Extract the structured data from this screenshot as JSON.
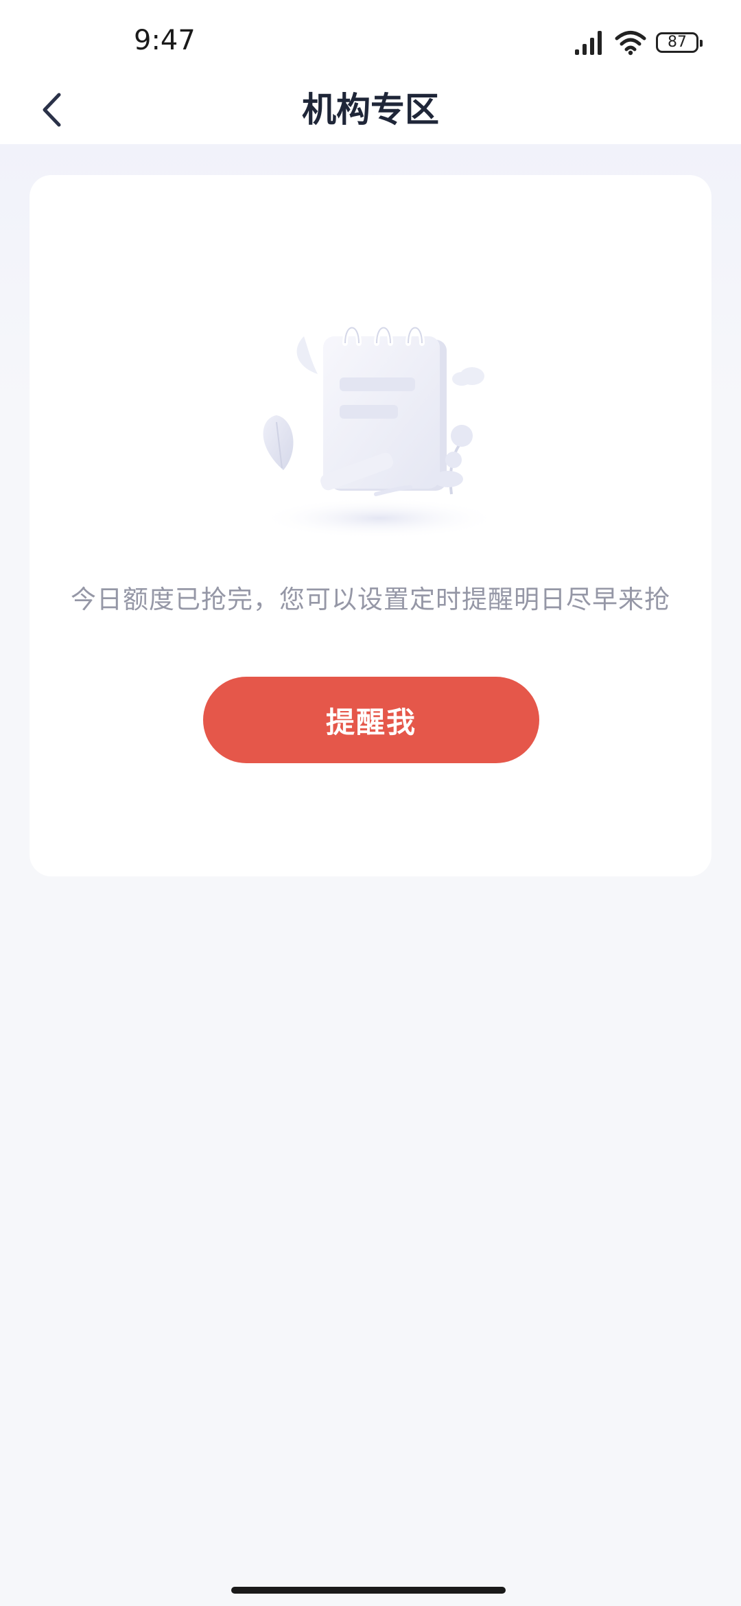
{
  "status_bar": {
    "time": "9:47",
    "battery_level": "87",
    "icons": [
      "signal-icon",
      "wifi-icon",
      "battery-icon"
    ]
  },
  "nav": {
    "back_icon": "chevron-left-icon",
    "title": "机构专区"
  },
  "empty_state": {
    "illustration": "empty-notepad-illustration",
    "message": "今日额度已抢完，您可以设置定时提醒明日尽早来抢",
    "button_label": "提醒我"
  },
  "colors": {
    "accent": "#e5574a",
    "title_text": "#1f2638",
    "muted_text": "#9597a6",
    "background": "#f6f7fa"
  }
}
